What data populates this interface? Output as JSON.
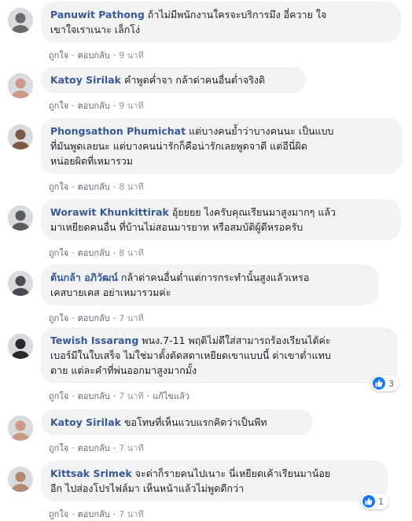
{
  "labels": {
    "like": "ถูกใจ",
    "reply": "ตอบกลับ",
    "separator": "·",
    "edited": "แก้ไขแล้ว"
  },
  "comments": [
    {
      "author": "Panuwit Pathong",
      "lines": [
        "ถ้าไม่มีพนักงานใครจะบริการมึง อี่ควาย ใจ",
        "เขาใจเราเนาะ เล็กโง่"
      ],
      "time": "9 นาที"
    },
    {
      "author": "Katoy Sirilak",
      "lines": [
        "คำพูดค่ำจา กล้าด่าคนอื่นต่ำจริงดิ"
      ],
      "time": "9 นาที"
    },
    {
      "author": "Phongsathon Phumichat",
      "lines": [
        "แต่บางคนย้ำว่าบางคนนะ เป็นแบบ",
        "ที่มันพูดเลยนะ แต่บางคนน่ารักก็คือน่ารักเลยพูดจาดี แต่อีนี่ผิด",
        "หน่อยผิดที่เหมารวม"
      ],
      "time": "8 นาที"
    },
    {
      "author": "Worawit Khunkittirak",
      "lines": [
        "อุ้ยยยย ไงครับคุณเรียนมาสูงมากๆ แล้ว",
        "มาเหยียดคนอื่น ที่บ้านไม่สอนมารยาท หรือสมบัติผู้ดีหรอครับ"
      ],
      "time": "8 นาที"
    },
    {
      "author": "ต้นกล้า อภิวัฒน์",
      "lines": [
        "กล้าด่าคนอื่นต่ำแต่การกระทำนั้นสูงแล้วเหรอ",
        "เคสบายเคส อย่าเหมารวมค่ะ"
      ],
      "time": "7 นาที"
    },
    {
      "author": "Tewish Issarang",
      "lines": [
        "พนง.7-11 พฤติไม่ดีใส่สามารถร้องเรียนได้ค่ะ",
        "เบอร์มีในใบเสร็จ ไม่ใช่มาตั้งตัดสดาเหยียดเขาแบบนี้ ด่าเขาต่ำแทบ",
        "ตาย แต่ละคำที่พ่นออกมาสูงมากมั้ง"
      ],
      "time": "7 นาที",
      "edited": true,
      "reactions": "3"
    },
    {
      "author": "Katoy Sirilak",
      "lines": [
        "ขอโทษที่เห็นแวบแรกคิดว่าเป็นพีท"
      ],
      "time": "7 นาที"
    },
    {
      "author": "Kittsak Srimek",
      "lines": [
        "จะด่าก็รายคนไปเนาะ นี่เหยียดเค้าเรียนมาน้อย",
        "อีก ไปส่องโปรไฟล์มา เห็นหน้าแล้วไม่พูดดีกว่า"
      ],
      "time": "7 นาที",
      "reactions": "1"
    }
  ],
  "colors": {
    "author": "#385898",
    "bubble": "#f2f3f5",
    "like": "#1877f2",
    "meta": "#616770"
  }
}
